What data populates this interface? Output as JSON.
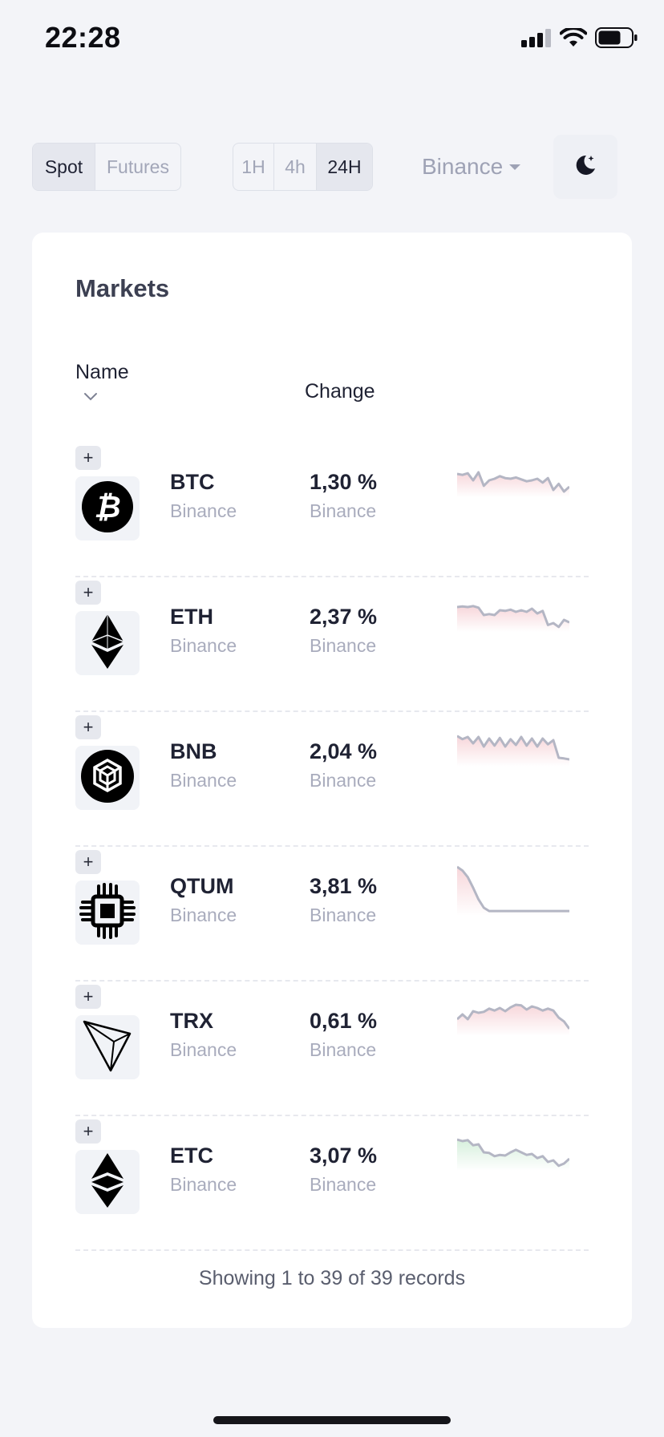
{
  "status_bar": {
    "time": "22:28"
  },
  "toolbar": {
    "market_types": [
      {
        "label": "Spot",
        "active": true
      },
      {
        "label": "Futures",
        "active": false
      }
    ],
    "timeframes": [
      {
        "label": "1H",
        "active": false
      },
      {
        "label": "4h",
        "active": false
      },
      {
        "label": "24H",
        "active": true
      }
    ],
    "exchange": "Binance",
    "theme_icon": "moon-stars-icon"
  },
  "markets": {
    "title": "Markets",
    "columns": {
      "name": "Name",
      "change": "Change"
    },
    "rows": [
      {
        "symbol": "BTC",
        "exchange": "Binance",
        "change": "1,30 %",
        "change_exchange": "Binance",
        "icon": "bitcoin-icon",
        "trend": "down",
        "spark": [
          0.35,
          0.38,
          0.33,
          0.55,
          0.3,
          0.72,
          0.55,
          0.5,
          0.42,
          0.48,
          0.5,
          0.46,
          0.52,
          0.58,
          0.55,
          0.5,
          0.62,
          0.48,
          0.85,
          0.66,
          0.9,
          0.75
        ]
      },
      {
        "symbol": "ETH",
        "exchange": "Binance",
        "change": "2,37 %",
        "change_exchange": "Binance",
        "icon": "ethereum-icon",
        "trend": "down",
        "spark": [
          0.3,
          0.28,
          0.3,
          0.27,
          0.32,
          0.55,
          0.52,
          0.55,
          0.4,
          0.42,
          0.38,
          0.45,
          0.4,
          0.45,
          0.35,
          0.5,
          0.42,
          0.86,
          0.8,
          0.92,
          0.7,
          0.78
        ]
      },
      {
        "symbol": "BNB",
        "exchange": "Binance",
        "change": "2,04 %",
        "change_exchange": "Binance",
        "icon": "bnb-icon",
        "trend": "down",
        "spark": [
          0.12,
          0.22,
          0.15,
          0.35,
          0.15,
          0.45,
          0.2,
          0.42,
          0.18,
          0.45,
          0.22,
          0.4,
          0.15,
          0.42,
          0.2,
          0.45,
          0.2,
          0.38,
          0.25,
          0.8,
          0.82,
          0.85
        ]
      },
      {
        "symbol": "QTUM",
        "exchange": "Binance",
        "change": "3,81 %",
        "change_exchange": "Binance",
        "icon": "qtum-icon",
        "trend": "down",
        "spark": [
          0.0,
          0.08,
          0.22,
          0.45,
          0.7,
          0.88,
          0.95,
          0.95,
          0.95,
          0.95,
          0.95,
          0.95,
          0.95,
          0.95,
          0.95,
          0.95,
          0.95,
          0.95,
          0.95,
          0.95,
          0.95,
          0.95
        ]
      },
      {
        "symbol": "TRX",
        "exchange": "Binance",
        "change": "0,61 %",
        "change_exchange": "Binance",
        "icon": "tron-icon",
        "trend": "down",
        "spark": [
          0.55,
          0.4,
          0.55,
          0.3,
          0.35,
          0.32,
          0.22,
          0.28,
          0.2,
          0.3,
          0.18,
          0.1,
          0.12,
          0.25,
          0.15,
          0.2,
          0.28,
          0.22,
          0.28,
          0.5,
          0.62,
          0.85
        ]
      },
      {
        "symbol": "ETC",
        "exchange": "Binance",
        "change": "3,07 %",
        "change_exchange": "Binance",
        "icon": "ethereum-classic-icon",
        "trend": "up",
        "spark": [
          0.1,
          0.15,
          0.12,
          0.28,
          0.25,
          0.5,
          0.52,
          0.62,
          0.58,
          0.6,
          0.5,
          0.42,
          0.5,
          0.58,
          0.55,
          0.68,
          0.62,
          0.8,
          0.75,
          0.92,
          0.85,
          0.7
        ]
      }
    ],
    "footer": "Showing 1 to 39 of 39 records"
  },
  "colors": {
    "background": "#f3f4f8",
    "card": "#ffffff",
    "spark_line": "#b4b6c4",
    "spark_fill_down": "#f7d6da",
    "spark_fill_up": "#d6efdc"
  }
}
